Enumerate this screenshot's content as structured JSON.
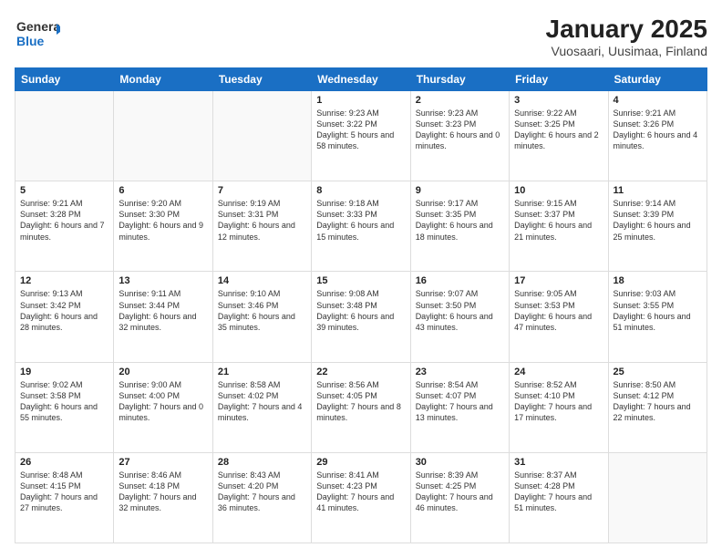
{
  "logo": {
    "text_general": "General",
    "text_blue": "Blue"
  },
  "title": "January 2025",
  "subtitle": "Vuosaari, Uusimaa, Finland",
  "days_header": [
    "Sunday",
    "Monday",
    "Tuesday",
    "Wednesday",
    "Thursday",
    "Friday",
    "Saturday"
  ],
  "weeks": [
    [
      {
        "day": "",
        "info": ""
      },
      {
        "day": "",
        "info": ""
      },
      {
        "day": "",
        "info": ""
      },
      {
        "day": "1",
        "info": "Sunrise: 9:23 AM\nSunset: 3:22 PM\nDaylight: 5 hours\nand 58 minutes."
      },
      {
        "day": "2",
        "info": "Sunrise: 9:23 AM\nSunset: 3:23 PM\nDaylight: 6 hours\nand 0 minutes."
      },
      {
        "day": "3",
        "info": "Sunrise: 9:22 AM\nSunset: 3:25 PM\nDaylight: 6 hours\nand 2 minutes."
      },
      {
        "day": "4",
        "info": "Sunrise: 9:21 AM\nSunset: 3:26 PM\nDaylight: 6 hours\nand 4 minutes."
      }
    ],
    [
      {
        "day": "5",
        "info": "Sunrise: 9:21 AM\nSunset: 3:28 PM\nDaylight: 6 hours\nand 7 minutes."
      },
      {
        "day": "6",
        "info": "Sunrise: 9:20 AM\nSunset: 3:30 PM\nDaylight: 6 hours\nand 9 minutes."
      },
      {
        "day": "7",
        "info": "Sunrise: 9:19 AM\nSunset: 3:31 PM\nDaylight: 6 hours\nand 12 minutes."
      },
      {
        "day": "8",
        "info": "Sunrise: 9:18 AM\nSunset: 3:33 PM\nDaylight: 6 hours\nand 15 minutes."
      },
      {
        "day": "9",
        "info": "Sunrise: 9:17 AM\nSunset: 3:35 PM\nDaylight: 6 hours\nand 18 minutes."
      },
      {
        "day": "10",
        "info": "Sunrise: 9:15 AM\nSunset: 3:37 PM\nDaylight: 6 hours\nand 21 minutes."
      },
      {
        "day": "11",
        "info": "Sunrise: 9:14 AM\nSunset: 3:39 PM\nDaylight: 6 hours\nand 25 minutes."
      }
    ],
    [
      {
        "day": "12",
        "info": "Sunrise: 9:13 AM\nSunset: 3:42 PM\nDaylight: 6 hours\nand 28 minutes."
      },
      {
        "day": "13",
        "info": "Sunrise: 9:11 AM\nSunset: 3:44 PM\nDaylight: 6 hours\nand 32 minutes."
      },
      {
        "day": "14",
        "info": "Sunrise: 9:10 AM\nSunset: 3:46 PM\nDaylight: 6 hours\nand 35 minutes."
      },
      {
        "day": "15",
        "info": "Sunrise: 9:08 AM\nSunset: 3:48 PM\nDaylight: 6 hours\nand 39 minutes."
      },
      {
        "day": "16",
        "info": "Sunrise: 9:07 AM\nSunset: 3:50 PM\nDaylight: 6 hours\nand 43 minutes."
      },
      {
        "day": "17",
        "info": "Sunrise: 9:05 AM\nSunset: 3:53 PM\nDaylight: 6 hours\nand 47 minutes."
      },
      {
        "day": "18",
        "info": "Sunrise: 9:03 AM\nSunset: 3:55 PM\nDaylight: 6 hours\nand 51 minutes."
      }
    ],
    [
      {
        "day": "19",
        "info": "Sunrise: 9:02 AM\nSunset: 3:58 PM\nDaylight: 6 hours\nand 55 minutes."
      },
      {
        "day": "20",
        "info": "Sunrise: 9:00 AM\nSunset: 4:00 PM\nDaylight: 7 hours\nand 0 minutes."
      },
      {
        "day": "21",
        "info": "Sunrise: 8:58 AM\nSunset: 4:02 PM\nDaylight: 7 hours\nand 4 minutes."
      },
      {
        "day": "22",
        "info": "Sunrise: 8:56 AM\nSunset: 4:05 PM\nDaylight: 7 hours\nand 8 minutes."
      },
      {
        "day": "23",
        "info": "Sunrise: 8:54 AM\nSunset: 4:07 PM\nDaylight: 7 hours\nand 13 minutes."
      },
      {
        "day": "24",
        "info": "Sunrise: 8:52 AM\nSunset: 4:10 PM\nDaylight: 7 hours\nand 17 minutes."
      },
      {
        "day": "25",
        "info": "Sunrise: 8:50 AM\nSunset: 4:12 PM\nDaylight: 7 hours\nand 22 minutes."
      }
    ],
    [
      {
        "day": "26",
        "info": "Sunrise: 8:48 AM\nSunset: 4:15 PM\nDaylight: 7 hours\nand 27 minutes."
      },
      {
        "day": "27",
        "info": "Sunrise: 8:46 AM\nSunset: 4:18 PM\nDaylight: 7 hours\nand 32 minutes."
      },
      {
        "day": "28",
        "info": "Sunrise: 8:43 AM\nSunset: 4:20 PM\nDaylight: 7 hours\nand 36 minutes."
      },
      {
        "day": "29",
        "info": "Sunrise: 8:41 AM\nSunset: 4:23 PM\nDaylight: 7 hours\nand 41 minutes."
      },
      {
        "day": "30",
        "info": "Sunrise: 8:39 AM\nSunset: 4:25 PM\nDaylight: 7 hours\nand 46 minutes."
      },
      {
        "day": "31",
        "info": "Sunrise: 8:37 AM\nSunset: 4:28 PM\nDaylight: 7 hours\nand 51 minutes."
      },
      {
        "day": "",
        "info": ""
      }
    ]
  ]
}
